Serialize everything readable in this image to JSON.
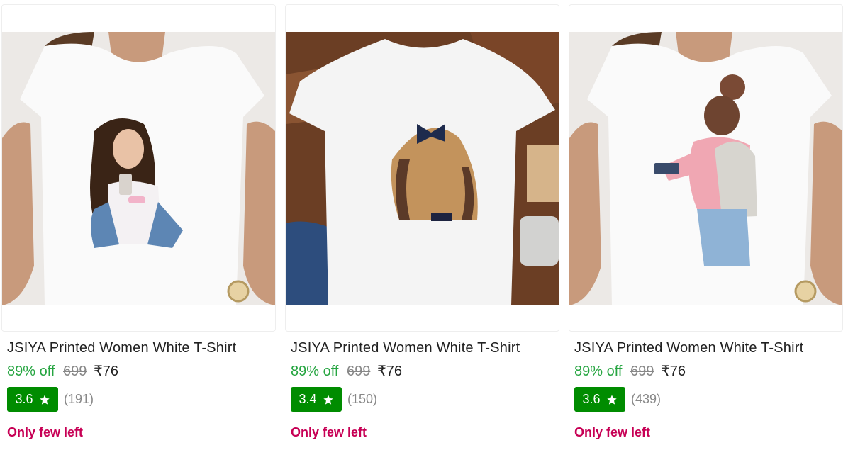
{
  "products": [
    {
      "title": "JSIYA Printed Women White T-Shirt",
      "discount": "89% off",
      "mrp": "699",
      "price": "₹76",
      "rating": "3.6",
      "reviews": "(191)",
      "stock": "Only few left",
      "image_icon": "tshirt-photo-girl-drink"
    },
    {
      "title": "JSIYA Printed Women White T-Shirt",
      "discount": "89% off",
      "mrp": "699",
      "price": "₹76",
      "rating": "3.4",
      "reviews": "(150)",
      "stock": "Only few left",
      "image_icon": "tshirt-photo-girl-bow"
    },
    {
      "title": "JSIYA Printed Women White T-Shirt",
      "discount": "89% off",
      "mrp": "699",
      "price": "₹76",
      "rating": "3.6",
      "reviews": "(439)",
      "stock": "Only few left",
      "image_icon": "tshirt-photo-girl-backpack"
    }
  ],
  "colors": {
    "discount": "#26a541",
    "rating_badge": "#008c00",
    "stock": "#c70055",
    "muted": "#878787"
  }
}
